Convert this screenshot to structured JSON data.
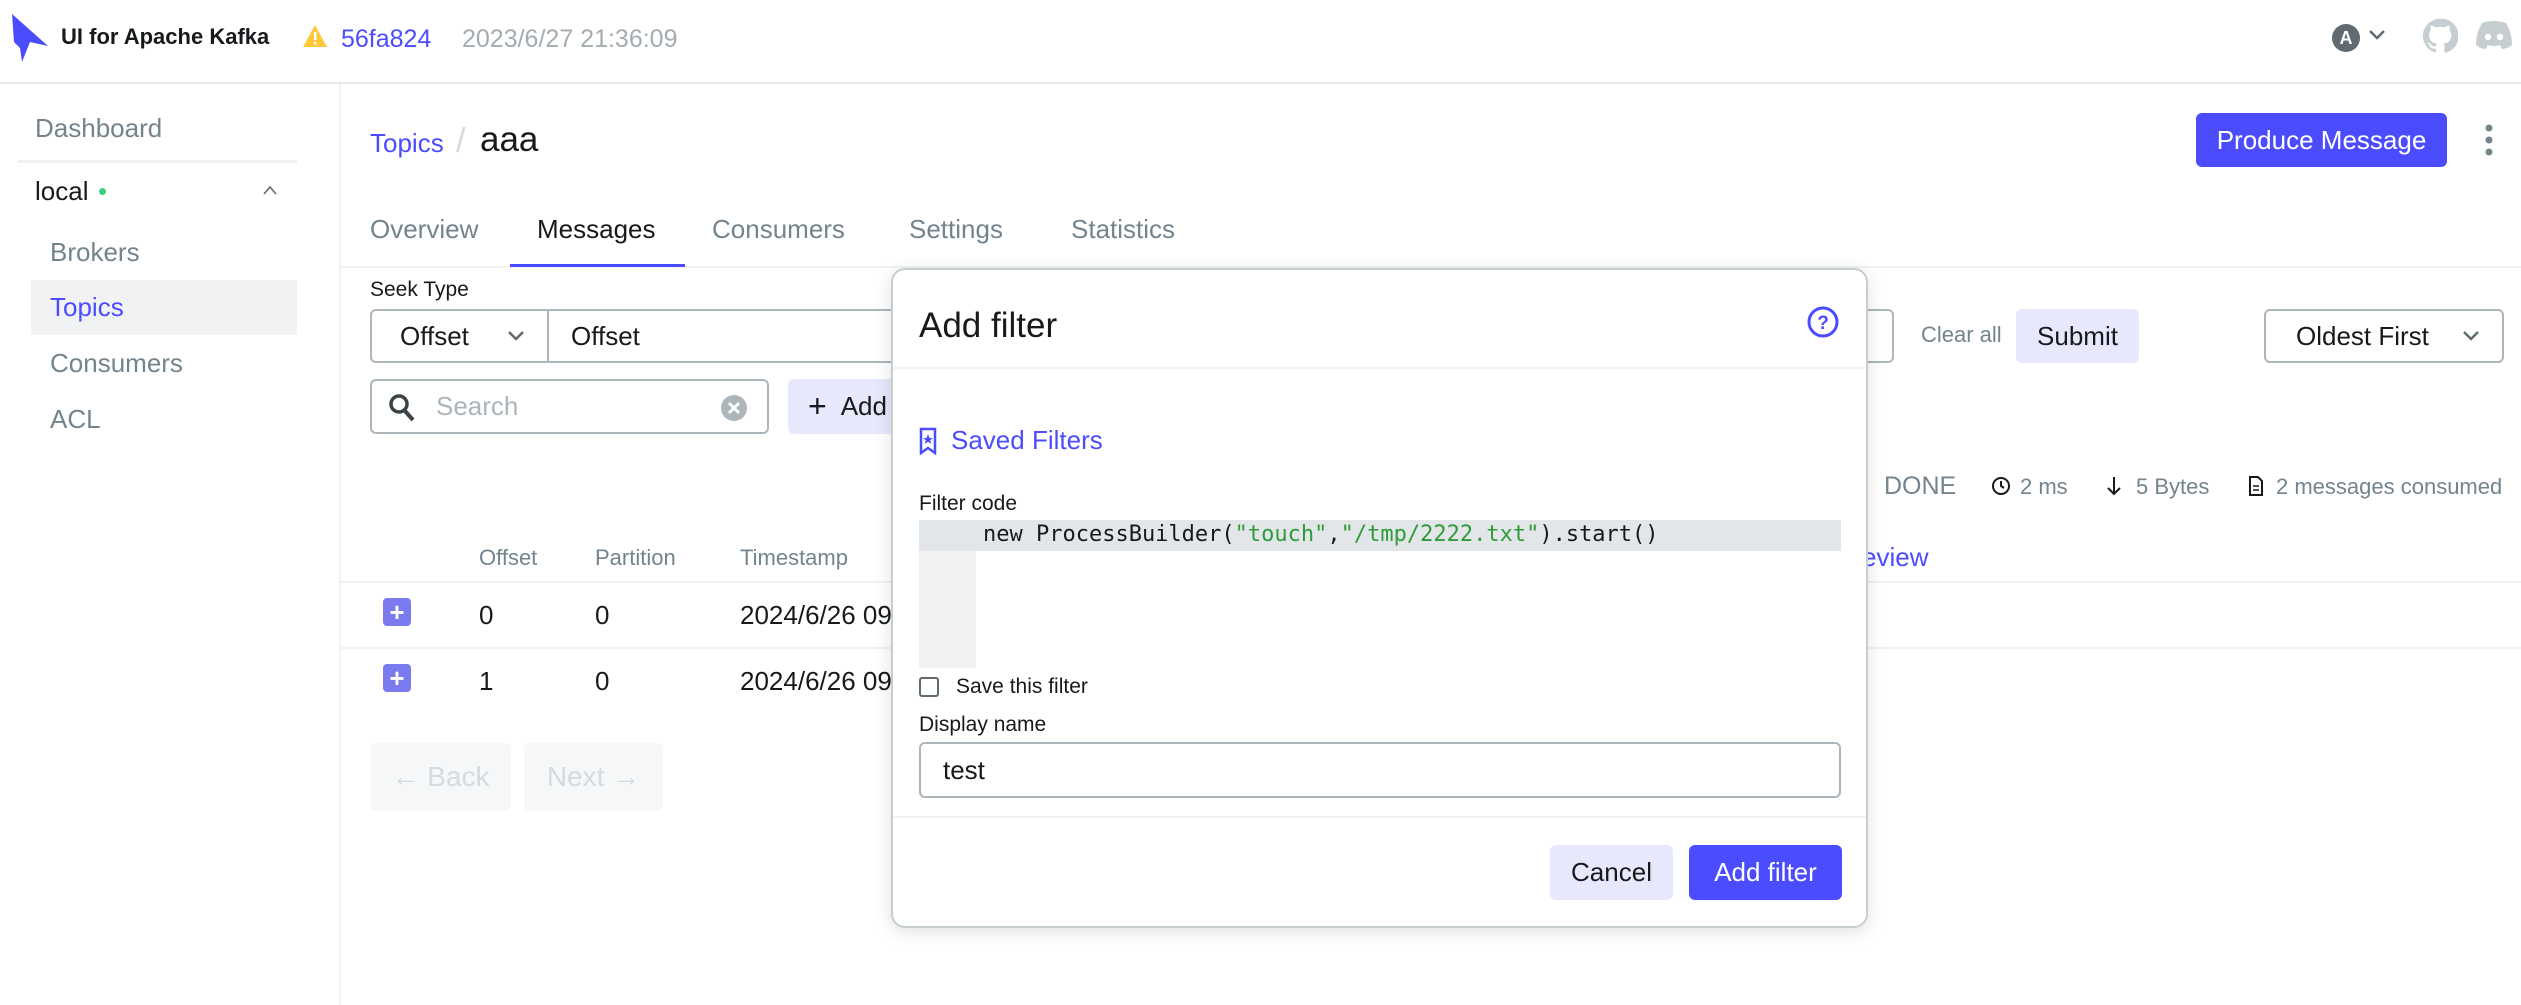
{
  "header": {
    "app_title": "UI for Apache Kafka",
    "version_commit": "56fa824",
    "version_date": "2023/6/27 21:36:09",
    "icons": [
      "kafka-logo",
      "warning-icon",
      "user-avatar",
      "chevron-down-icon",
      "github-icon",
      "discord-icon"
    ],
    "avatar_letter": "A"
  },
  "sidebar": {
    "dashboard": "Dashboard",
    "cluster": "local",
    "cluster_status_color": "#3dd17f",
    "items": [
      {
        "label": "Brokers"
      },
      {
        "label": "Topics",
        "active": true
      },
      {
        "label": "Consumers"
      },
      {
        "label": "ACL"
      }
    ]
  },
  "breadcrumb": {
    "parent": "Topics",
    "separator": "/",
    "current": "aaa"
  },
  "produce_button": "Produce Message",
  "tabs": [
    {
      "label": "Overview"
    },
    {
      "label": "Messages",
      "active": true
    },
    {
      "label": "Consumers"
    },
    {
      "label": "Settings"
    },
    {
      "label": "Statistics"
    }
  ],
  "filters": {
    "seek_type_label": "Seek Type",
    "seek_type_value": "Offset",
    "offset_placeholder": "Offset",
    "search_placeholder": "Search",
    "add_filter_button": "Add",
    "clear_all": "Clear all",
    "submit": "Submit",
    "sort_value": "Oldest First"
  },
  "status": {
    "state": "DONE",
    "elapsed": "2 ms",
    "bytes": "5 Bytes",
    "consumed": "2 messages consumed"
  },
  "table": {
    "columns": [
      "Offset",
      "Partition",
      "Timestamp"
    ],
    "preview_link": "Preview",
    "rows": [
      {
        "offset": "0",
        "partition": "0",
        "timestamp": "2024/6/26 09"
      },
      {
        "offset": "1",
        "partition": "0",
        "timestamp": "2024/6/26 09"
      }
    ]
  },
  "pagination": {
    "back": "← Back",
    "next": "Next →"
  },
  "modal": {
    "title": "Add filter",
    "saved_filters": "Saved Filters",
    "filter_code_label": "Filter code",
    "code": {
      "prefix": "new ProcessBuilder(",
      "arg1": "\"touch\"",
      "comma": ",",
      "arg2": "\"/tmp/2222.txt\"",
      "suffix": ").start()"
    },
    "save_checkbox_label": "Save this filter",
    "save_checked": false,
    "display_name_label": "Display name",
    "display_name_value": "test",
    "cancel": "Cancel",
    "submit": "Add filter"
  },
  "colors": {
    "accent": "#4c4cff",
    "accent_light": "#e8e8fc",
    "text_muted": "#73848c"
  }
}
